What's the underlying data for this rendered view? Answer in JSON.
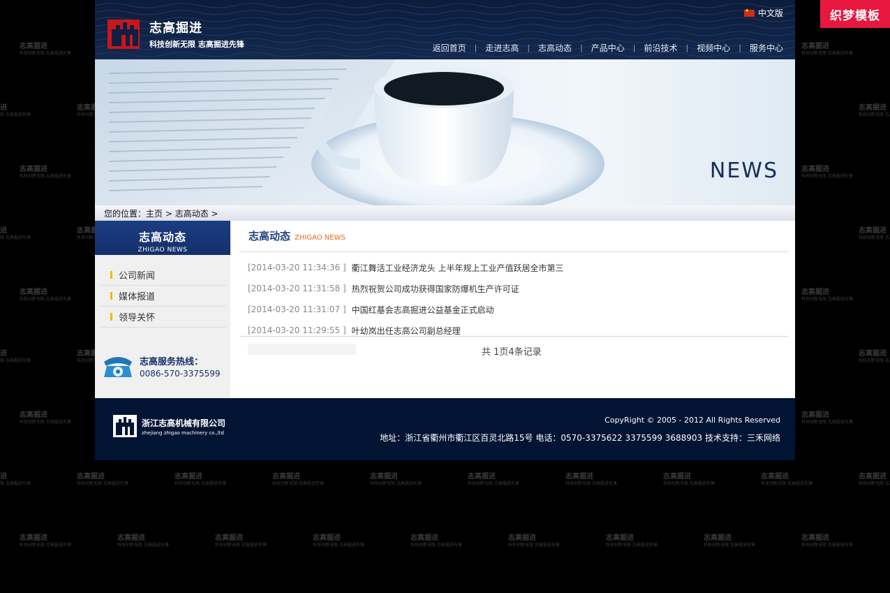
{
  "corner_badge": "织梦模板",
  "header": {
    "logo_title": "志高掘进",
    "logo_slogan": "科技创新无限 志高掘进先锋",
    "language": "中文版",
    "nav": [
      "返回首页",
      "走进志高",
      "志高动态",
      "产品中心",
      "前沿技术",
      "视频中心",
      "服务中心"
    ]
  },
  "banner": {
    "text": "NEWS"
  },
  "breadcrumb": {
    "prefix": "您的位置：",
    "home": "主页",
    "sep": " > ",
    "current": "志高动态",
    "tail": " >"
  },
  "sidebar": {
    "title_cn": "志高动态",
    "title_en": "ZHIGAO NEWS",
    "menu": [
      "公司新闻",
      "媒体报道",
      "领导关怀"
    ],
    "hotline_label": "志高服务热线：",
    "hotline_number": "0086-570-3375599"
  },
  "main": {
    "title_cn": "志高动态",
    "title_en": "ZHIGAO NEWS",
    "news": [
      {
        "date": "[2014-03-20 11:34:36 ]",
        "title": "衢江舞活工业经济龙头 上半年规上工业产值跃居全市第三"
      },
      {
        "date": "[2014-03-20 11:31:58 ]",
        "title": "热烈祝贺公司成功获得国家防爆机生产许可证"
      },
      {
        "date": "[2014-03-20 11:31:07 ]",
        "title": "中国红基会志高掘进公益基金正式启动"
      },
      {
        "date": "[2014-03-20 11:29:55 ]",
        "title": "叶幼岚出任志高公司副总经理"
      }
    ],
    "pager": "共 1页4条记录"
  },
  "footer": {
    "company_cn": "浙江志高机械有限公司",
    "company_en": "zhejiang zhigao machinery co.,ltd",
    "copyright": "CopyRight © 2005 - 2012  All Rights Reserved",
    "address": "地址：浙江省衢州市衢江区百灵北路15号  电话：0570-3375622 3375599 3688903   技术支持：三禾网络"
  },
  "watermark": {
    "main": "志高掘进",
    "sub": "科技创新无限 志高掘进先锋"
  },
  "colors": {
    "navy": "#14306c",
    "footer": "#011434",
    "accent_red": "#e8173f",
    "bullet_yellow": "#f2b900",
    "title_orange": "#e36a1e"
  }
}
